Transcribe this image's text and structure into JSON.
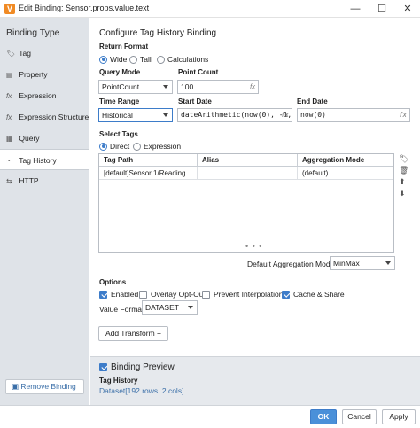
{
  "window": {
    "title": "Edit Binding: Sensor.props.value.text",
    "app_icon": "V"
  },
  "sidebar": {
    "header": "Binding Type",
    "items": [
      {
        "label": "Tag",
        "icon": "tag-icon",
        "glyph": "🏷"
      },
      {
        "label": "Property",
        "icon": "property-icon",
        "glyph": "▤"
      },
      {
        "label": "Expression",
        "icon": "fx-icon",
        "glyph": "fx"
      },
      {
        "label": "Expression Structure",
        "icon": "fx-icon",
        "glyph": "fx"
      },
      {
        "label": "Query",
        "icon": "query-icon",
        "glyph": "▦"
      },
      {
        "label": "Tag History",
        "icon": "history-icon",
        "glyph": "◔"
      },
      {
        "label": "HTTP",
        "icon": "http-icon",
        "glyph": "⇆"
      }
    ],
    "active_index": 5,
    "remove_button": "Remove Binding"
  },
  "config": {
    "title": "Configure Tag History Binding",
    "return_format": {
      "label": "Return Format",
      "options": [
        "Wide",
        "Tall",
        "Calculations"
      ],
      "selected": "Wide"
    },
    "query_mode": {
      "label": "Query Mode",
      "value": "PointCount"
    },
    "point_count": {
      "label": "Point Count",
      "value": "100"
    },
    "time_range": {
      "label": "Time Range",
      "value": "Historical"
    },
    "start_date": {
      "label": "Start Date",
      "value": "dateArithmetic(now(0), -1, "
    },
    "end_date": {
      "label": "End Date",
      "value": "now(0)"
    },
    "select_tags": {
      "label": "Select Tags",
      "options": [
        "Direct",
        "Expression"
      ],
      "selected": "Direct"
    },
    "table": {
      "columns": [
        "Tag Path",
        "Alias",
        "Aggregation Mode"
      ],
      "rows": [
        [
          "[default]Sensor 1/Reading",
          "",
          "(default)"
        ]
      ]
    },
    "default_aggregation": {
      "label": "Default Aggregation Mode",
      "value": "MinMax"
    },
    "options": {
      "label": "Options",
      "enabled": {
        "label": "Enabled",
        "checked": true
      },
      "overlay_opt_out": {
        "label": "Overlay Opt-Out",
        "checked": false
      },
      "prevent_interpolation": {
        "label": "Prevent Interpolation",
        "checked": false
      },
      "cache_share": {
        "label": "Cache & Share",
        "checked": true
      }
    },
    "value_format": {
      "label": "Value Format",
      "value": "DATASET"
    },
    "add_transform": "Add Transform +"
  },
  "preview": {
    "label": "Binding Preview",
    "checked": true,
    "source": "Tag History",
    "result": "Dataset[192 rows, 2 cols]"
  },
  "footer": {
    "ok": "OK",
    "cancel": "Cancel",
    "apply": "Apply"
  },
  "colors": {
    "accent": "#3d7cc9",
    "sidebar": "#dfe3e8",
    "preview_bg": "#e6e9ed"
  }
}
